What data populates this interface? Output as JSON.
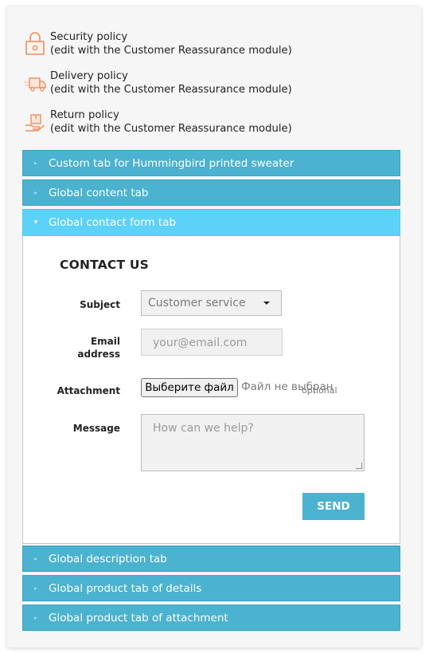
{
  "reassurance": [
    {
      "icon": "lock-icon",
      "title": "Security policy",
      "subtitle": "(edit with the Customer Reassurance module)"
    },
    {
      "icon": "delivery-truck-icon",
      "title": "Delivery policy",
      "subtitle": "(edit with the Customer Reassurance module)"
    },
    {
      "icon": "return-box-icon",
      "title": "Return policy",
      "subtitle": "(edit with the Customer Reassurance module)"
    }
  ],
  "tabs": [
    {
      "label": "Custom tab for Hummingbird printed sweater",
      "expanded": false
    },
    {
      "label": "Global content tab",
      "expanded": false
    },
    {
      "label": "Global contact form tab",
      "expanded": true
    },
    {
      "label": "Global description tab",
      "expanded": false
    },
    {
      "label": "Global product tab of details",
      "expanded": false
    },
    {
      "label": "Global product tab of attachment",
      "expanded": false
    }
  ],
  "contact_form": {
    "title": "CONTACT US",
    "subject_label": "Subject",
    "subject_value": "Customer service",
    "email_label_line1": "Email",
    "email_label_line2": "address",
    "email_placeholder": "your@email.com",
    "attachment_label": "Attachment",
    "file_button": "Выберите файл",
    "file_status": "Файл не выбран",
    "optional_note": "optional",
    "message_label": "Message",
    "message_placeholder": "How can we help?",
    "send_label": "SEND"
  },
  "colors": {
    "tab": "#4bb2cf",
    "tab_active": "#5cd2f8",
    "icon_accent": "#f08c5a",
    "text": "#232323"
  }
}
